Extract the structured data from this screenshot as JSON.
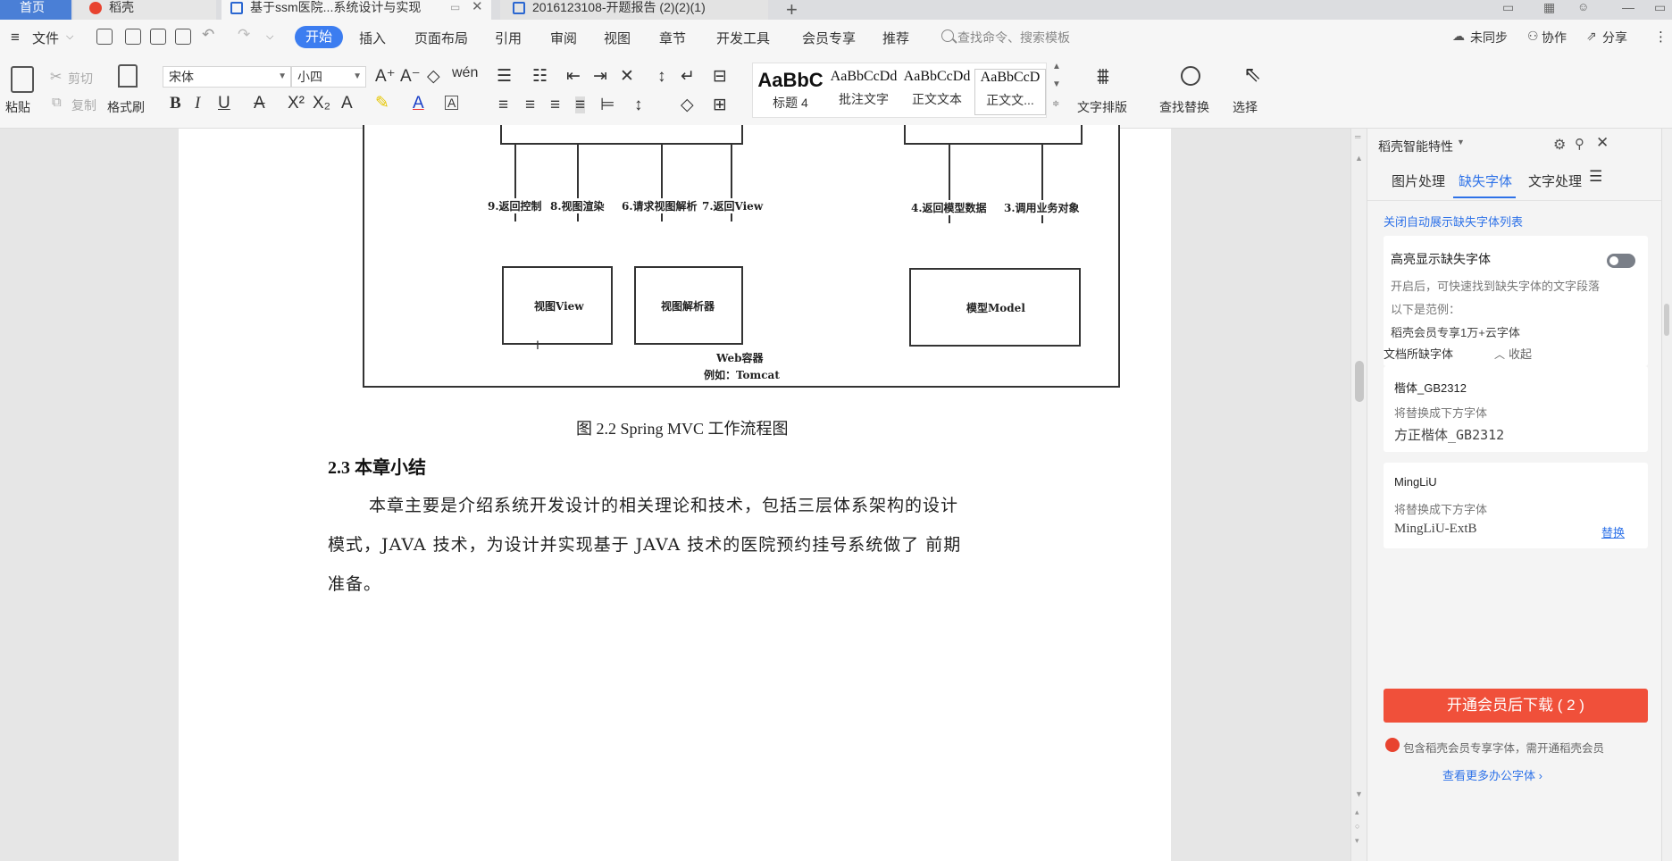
{
  "tabs": {
    "home": "首页",
    "daoke": "稻壳",
    "active_doc": "基于ssm医院...系统设计与实现",
    "other_doc": "2016123108-开题报告 (2)(2)(1)"
  },
  "menu": {
    "file": "文件",
    "items": [
      "开始",
      "插入",
      "页面布局",
      "引用",
      "审阅",
      "视图",
      "章节",
      "开发工具",
      "会员专享",
      "推荐"
    ],
    "search_placeholder": "查找命令、搜索模板",
    "sync": "未同步",
    "collab": "协作",
    "share": "分享"
  },
  "ribbon": {
    "paste": "粘贴",
    "cut": "剪切",
    "copy": "复制",
    "format_painter": "格式刷",
    "font_name": "宋体",
    "font_size": "小四",
    "styles": [
      {
        "preview": "AaBbC",
        "name": "标题 4"
      },
      {
        "preview": "AaBbCcDd",
        "name": "批注文字"
      },
      {
        "preview": "AaBbCcDd",
        "name": "正文文本"
      },
      {
        "preview": "AaBbCcD",
        "name": "正文文..."
      }
    ],
    "text_layout": "文字排版",
    "find_replace": "查找替换",
    "select": "选择"
  },
  "diagram": {
    "label_return_control": "9.返回控制",
    "label_view_render": "8.视图渲染",
    "label_view_resolve": "6.请求视图解析",
    "label_return_view": "7.返回View",
    "label_return_model": "4.返回模型数据",
    "label_call_service": "3.调用业务对象",
    "box_view": "视图View",
    "box_resolver": "视图解析器",
    "box_model": "模型Model",
    "container": "Web容器",
    "example": "例如：Tomcat"
  },
  "document": {
    "caption": "图 2.2 Spring MVC 工作流程图",
    "heading": "2.3 本章小结",
    "para_line1": "本章主要是介绍系统开发设计的相关理论和技术，包括三层体系架构的设计",
    "para_line2": "模式，JAVA 技术，为设计并实现基于 JAVA 技术的医院预约挂号系统做了 前期",
    "para_line3": "准备。"
  },
  "panel": {
    "title": "稻壳智能特性",
    "tabs": [
      "图片处理",
      "缺失字体",
      "文字处理"
    ],
    "close_auto_list": "关闭自动展示缺失字体列表",
    "highlight_title": "高亮显示缺失字体",
    "highlight_desc": "开启后，可快速找到缺失字体的文字段落",
    "example_label": "以下是范例：",
    "example_text": "稻壳会员专享1万+云字体",
    "collapse": "收起",
    "missing_fonts_title": "文档所缺字体",
    "font1_name": "楷体_GB2312",
    "font1_replace_label": "将替换成下方字体",
    "font1_target": "方正楷体_GB2312",
    "font2_name": "MingLiU",
    "font2_replace_label": "将替换成下方字体",
    "font2_target": "MingLiU-ExtB",
    "replace_link": "替换",
    "download_btn": "开通会员后下载 ( 2 )",
    "note": "包含稻壳会员专享字体，需开通稻壳会员",
    "more_fonts": "查看更多办公字体 ›"
  }
}
